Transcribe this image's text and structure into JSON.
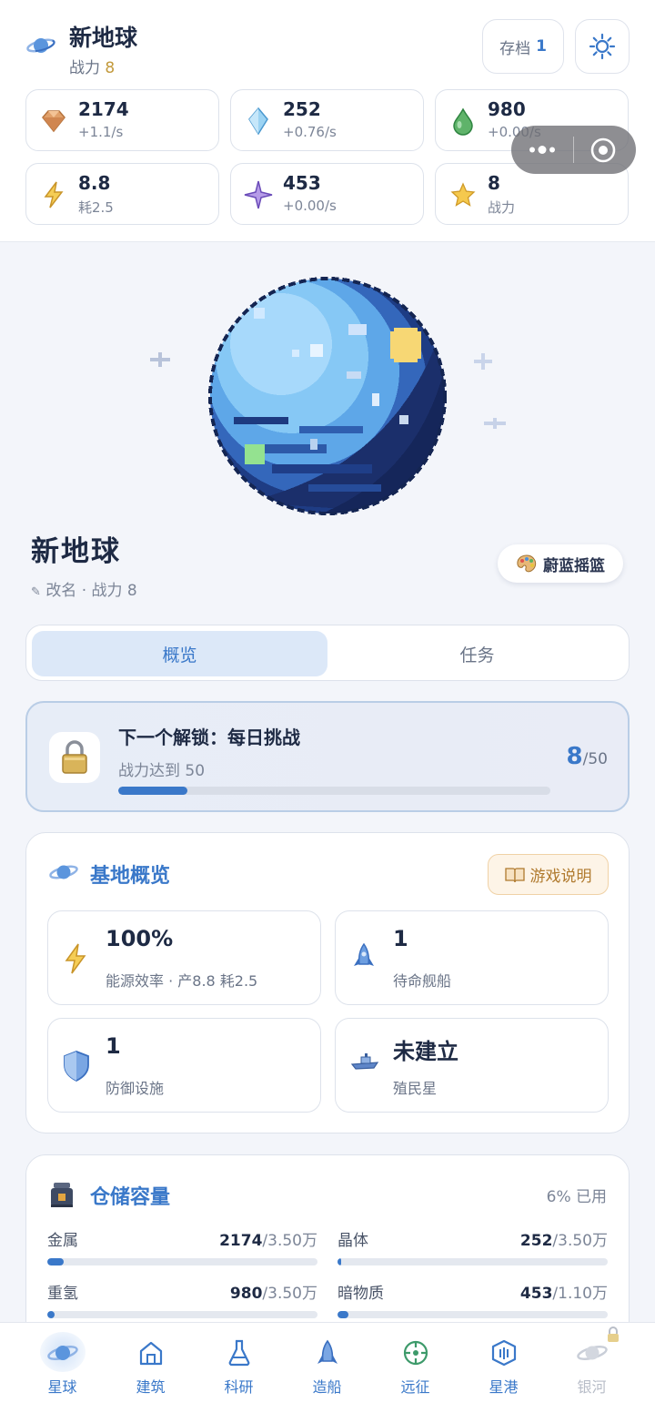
{
  "header": {
    "title": "新地球",
    "power_label": "战力",
    "power_value": "8",
    "save_label": "存档",
    "save_value": "1"
  },
  "resources": [
    {
      "icon": "metal-ore-icon",
      "value": "2174",
      "rate": "+1.1/s"
    },
    {
      "icon": "crystal-icon",
      "value": "252",
      "rate": "+0.76/s"
    },
    {
      "icon": "deuterium-drop-icon",
      "value": "980",
      "rate": "+0.00/s"
    },
    {
      "icon": "energy-bolt-icon",
      "value": "8.8",
      "rate": "耗2.5"
    },
    {
      "icon": "dark-matter-star-icon",
      "value": "453",
      "rate": "+0.00/s"
    },
    {
      "icon": "power-star-icon",
      "value": "8",
      "rate": "战力"
    }
  ],
  "planet": {
    "name": "新地球",
    "meta": "改名 · 战力 8",
    "biome_label": "蔚蓝摇篮"
  },
  "tabs": [
    {
      "label": "概览",
      "active": true
    },
    {
      "label": "任务",
      "active": false
    }
  ],
  "unlock": {
    "title": "下一个解锁：每日挑战",
    "subtitle": "战力达到 50",
    "current": "8",
    "target": "/50",
    "progress": 0.16
  },
  "overview": {
    "title": "基地概览",
    "guide_label": "游戏说明",
    "stats": [
      {
        "icon": "energy-bolt-icon",
        "value": "100%",
        "label": "能源效率 · 产8.8 耗2.5"
      },
      {
        "icon": "rocket-icon",
        "value": "1",
        "label": "待命舰船"
      },
      {
        "icon": "shield-icon",
        "value": "1",
        "label": "防御设施"
      },
      {
        "icon": "colony-ship-icon",
        "value": "未建立",
        "label": "殖民星"
      }
    ]
  },
  "storage": {
    "title": "仓储容量",
    "used": "6% 已用",
    "items": [
      {
        "name": "金属",
        "amount": "2174",
        "cap": "/3.50万",
        "fill": 0.062
      },
      {
        "name": "晶体",
        "amount": "252",
        "cap": "/3.50万",
        "fill": 0.007
      },
      {
        "name": "重氢",
        "amount": "980",
        "cap": "/3.50万",
        "fill": 0.028
      },
      {
        "name": "暗物质",
        "amount": "453",
        "cap": "/1.10万",
        "fill": 0.041
      }
    ]
  },
  "nav": [
    {
      "label": "星球",
      "icon": "planet-icon",
      "active": true
    },
    {
      "label": "建筑",
      "icon": "building-icon"
    },
    {
      "label": "科研",
      "icon": "flask-icon"
    },
    {
      "label": "造船",
      "icon": "ship-icon"
    },
    {
      "label": "远征",
      "icon": "crosshair-icon"
    },
    {
      "label": "星港",
      "icon": "starport-icon"
    },
    {
      "label": "银河",
      "icon": "galaxy-icon",
      "locked": true
    }
  ],
  "colors": {
    "accent": "#3a78c9",
    "gold": "#c39a3c",
    "guide_text": "#b07a2e"
  }
}
